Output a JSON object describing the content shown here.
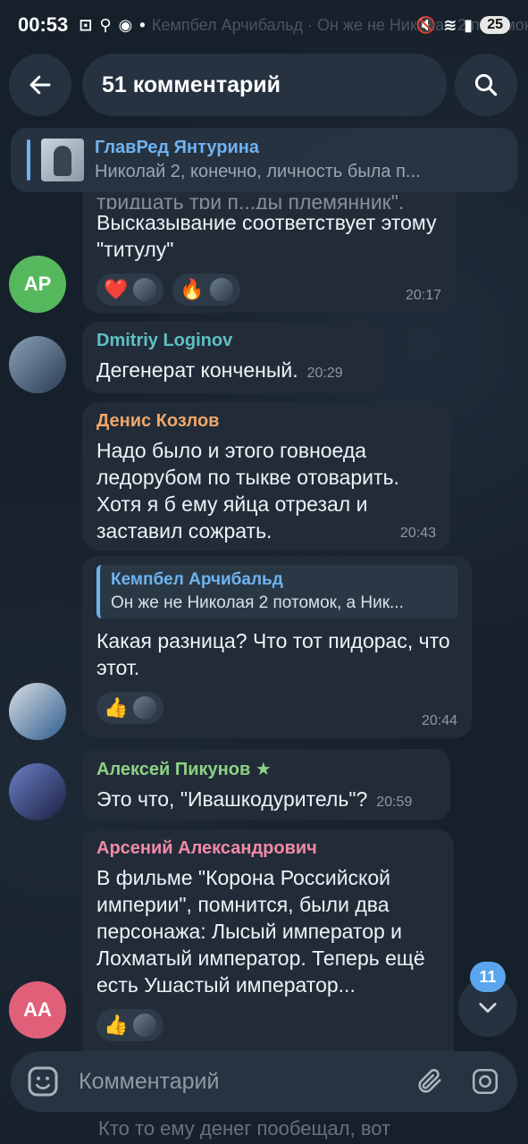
{
  "status_bar": {
    "time": "00:53",
    "battery": "25",
    "icons": [
      "screen-record-icon",
      "search-icon",
      "app-icon",
      "dot-icon",
      "mute-icon",
      "wifi-icon",
      "signal-icon"
    ]
  },
  "background_text": {
    "top": "Кемпбел Арчибальд · Он же не Николая 2 потомок, а Ник…",
    "bottom": "Кто то ему денег пообещал, вот"
  },
  "header": {
    "title": "51 комментарий"
  },
  "pinned": {
    "name": "ГлавРед Янтурина",
    "text": "Николай 2, конечно, личность была п..."
  },
  "messages": [
    {
      "avatar_initials": "AP",
      "text_partial": "тридцать три п...ды племянник\".",
      "text": "Высказывание соответствует этому \"титулу\"",
      "reactions": [
        "❤️",
        "🔥"
      ],
      "time": "20:17"
    },
    {
      "author": "Dmitriy Loginov",
      "text": "Дегенерат конченый.",
      "time": "20:29"
    },
    {
      "author": "Денис Козлов",
      "text": "Надо было и этого говноеда ледорубом по тыкве отоварить. Хотя я б ему яйца отрезал и заставил сожрать.",
      "time": "20:43"
    },
    {
      "quote_name": "Кемпбел Арчибальд",
      "quote_text": "Он же не Николая 2 потомок, а Ник...",
      "text": "Какая разница? Что тот пидорас, что этот.",
      "reactions": [
        "👍"
      ],
      "time": "20:44"
    },
    {
      "author": "Алексей Пикунов",
      "text": "Это что, \"Ивашкодуритель\"?",
      "time": "20:59"
    },
    {
      "author": "Арсений Александрович",
      "avatar_initials": "AA",
      "text": "В фильме \"Корона Российской империи\", помнится, были два персонажа: Лысый император и Лохматый император. Теперь ещё есть Ушастый император...",
      "reactions": [
        "👍"
      ]
    }
  ],
  "unread_count": "11",
  "input": {
    "placeholder": "Комментарий"
  },
  "colors": {
    "accent": "#6fb3f0",
    "author_teal": "#5fc0c2",
    "author_orange": "#f0a66a",
    "author_green": "#8ed184",
    "author_pink": "#f08aa6",
    "avatar_ap": "#56b85c",
    "avatar_aa": "#e0607a"
  }
}
